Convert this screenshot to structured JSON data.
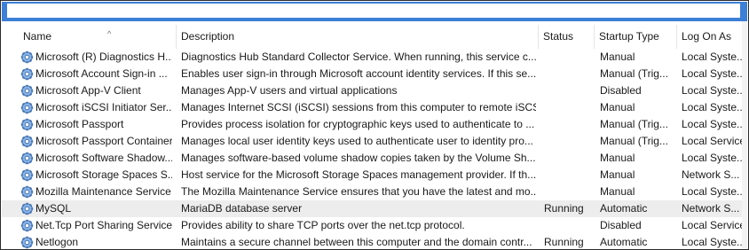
{
  "columns": {
    "name": "Name",
    "description": "Description",
    "status": "Status",
    "startup": "Startup Type",
    "logon": "Log On As"
  },
  "sort_indicator": "^",
  "rows": [
    {
      "name": "Microsoft (R) Diagnostics H...",
      "description": "Diagnostics Hub Standard Collector Service. When running, this service c...",
      "status": "",
      "startup": "Manual",
      "logon": "Local Syste..."
    },
    {
      "name": "Microsoft Account Sign-in ...",
      "description": "Enables user sign-in through Microsoft account identity services. If this se...",
      "status": "",
      "startup": "Manual (Trig...",
      "logon": "Local Syste..."
    },
    {
      "name": "Microsoft App-V Client",
      "description": "Manages App-V users and virtual applications",
      "status": "",
      "startup": "Disabled",
      "logon": "Local Syste..."
    },
    {
      "name": "Microsoft iSCSI Initiator Ser...",
      "description": "Manages Internet SCSI (iSCSI) sessions from this computer to remote iSCS...",
      "status": "",
      "startup": "Manual",
      "logon": "Local Syste..."
    },
    {
      "name": "Microsoft Passport",
      "description": "Provides process isolation for cryptographic keys used to authenticate to ...",
      "status": "",
      "startup": "Manual (Trig...",
      "logon": "Local Syste..."
    },
    {
      "name": "Microsoft Passport Container",
      "description": "Manages local user identity keys used to authenticate user to identity pro...",
      "status": "",
      "startup": "Manual (Trig...",
      "logon": "Local Service"
    },
    {
      "name": "Microsoft Software Shadow...",
      "description": "Manages software-based volume shadow copies taken by the Volume Sh...",
      "status": "",
      "startup": "Manual",
      "logon": "Local Syste..."
    },
    {
      "name": "Microsoft Storage Spaces S...",
      "description": "Host service for the Microsoft Storage Spaces management provider. If th...",
      "status": "",
      "startup": "Manual",
      "logon": "Network S..."
    },
    {
      "name": "Mozilla Maintenance Service",
      "description": "The Mozilla Maintenance Service ensures that you have the latest and mo...",
      "status": "",
      "startup": "Manual",
      "logon": "Local Syste..."
    },
    {
      "name": "MySQL",
      "description": "MariaDB database server",
      "status": "Running",
      "startup": "Automatic",
      "logon": "Network S...",
      "selected": true
    },
    {
      "name": "Net.Tcp Port Sharing Service",
      "description": "Provides ability to share TCP ports over the net.tcp protocol.",
      "status": "",
      "startup": "Disabled",
      "logon": "Local Service"
    },
    {
      "name": "Netlogon",
      "description": "Maintains a secure channel between this computer and the domain contr...",
      "status": "Running",
      "startup": "Automatic",
      "logon": "Local Syste..."
    }
  ]
}
